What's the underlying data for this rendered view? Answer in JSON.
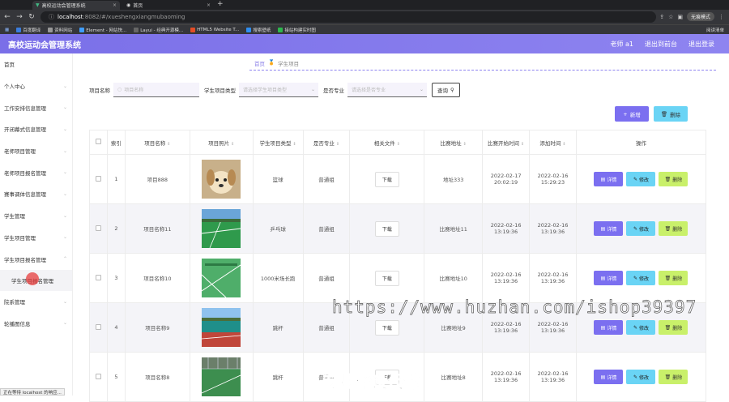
{
  "browser": {
    "tabs": [
      {
        "label": "高校运动会管理系统"
      },
      {
        "label": "首页"
      }
    ],
    "url_host": "localhost",
    "url_path": ":8082/#/xueshengxiangmubaoming",
    "profile": "无痕模式",
    "bookmarks": [
      "百度翻译",
      "资料网站",
      "Element - 网站快...",
      "Layui - 经典开源模...",
      "HTML5 Website T...",
      "搜索壁纸",
      "接站构建实时图"
    ],
    "bookmarks_right": "阅读清单"
  },
  "app": {
    "title": "高校运动会管理系统",
    "header_links": [
      "老师 a1",
      "退出到前台",
      "退出登录"
    ]
  },
  "sidebar": {
    "items": [
      {
        "label": "首页",
        "chev": ""
      },
      {
        "label": "个人中心",
        "chev": "⌄"
      },
      {
        "label": "工作安排信息管理",
        "chev": "⌄"
      },
      {
        "label": "开闭幕式信息管理",
        "chev": "⌄"
      },
      {
        "label": "老师项目管理",
        "chev": "⌄"
      },
      {
        "label": "老师项目报名管理",
        "chev": "⌄"
      },
      {
        "label": "赛事调体信息管理",
        "chev": "⌄"
      },
      {
        "label": "学生管理",
        "chev": "⌄"
      },
      {
        "label": "学生项目管理",
        "chev": "⌄"
      },
      {
        "label": "学生项目报名管理",
        "chev": "⌃"
      },
      {
        "label": "学生项目报名管理",
        "chev": "",
        "sub": true
      },
      {
        "label": "院系管理",
        "chev": "⌄"
      },
      {
        "label": "轮播图信息",
        "chev": "⌄"
      }
    ]
  },
  "breadcrumb": {
    "home": "首页",
    "current": "学生项目"
  },
  "filters": {
    "name_label": "项目名称",
    "name_placeholder": "项目名称",
    "type_label": "学生项目类型",
    "type_placeholder": "请选择学生项目类型",
    "major_label": "是否专业",
    "major_placeholder": "请选择是否专业",
    "query_label": "查询"
  },
  "actions": {
    "add": "新增",
    "delete": "删除"
  },
  "table": {
    "headers": [
      "索引",
      "项目名称",
      "项目照片",
      "学生项目类型",
      "是否专业",
      "相关文件",
      "比赛地址",
      "比赛开始时间",
      "添加时间",
      "操作"
    ],
    "download_label": "下载",
    "op_labels": [
      "详情",
      "修改",
      "删除"
    ],
    "rows": [
      {
        "index": "1",
        "name": "项目888",
        "type": "篮球",
        "major": "普通组",
        "addr": "地址333",
        "start": "2022-02-17 20:02:19",
        "added": "2022-02-16 15:29:23",
        "thumb": "dog"
      },
      {
        "index": "2",
        "name": "项目名称11",
        "type": "乒乓球",
        "major": "普通组",
        "addr": "比赛地址11",
        "start": "2022-02-16 13:19:36",
        "added": "2022-02-16 13:19:36",
        "thumb": "field1"
      },
      {
        "index": "3",
        "name": "项目名称10",
        "type": "1000米场长跑",
        "major": "普通组",
        "addr": "比赛地址10",
        "start": "2022-02-16 13:19:36",
        "added": "2022-02-16 13:19:36",
        "thumb": "field2"
      },
      {
        "index": "4",
        "name": "项目名称9",
        "type": "跳杆",
        "major": "普通组",
        "addr": "比赛地址9",
        "start": "2022-02-16 13:19:36",
        "added": "2022-02-16 13:19:36",
        "thumb": "field3"
      },
      {
        "index": "5",
        "name": "项目名称8",
        "type": "跳杆",
        "major": "普通组",
        "addr": "比赛地址8",
        "start": "2022-02-16 13:19:36",
        "added": "2022-02-16 13:19:36",
        "thumb": "field4"
      }
    ]
  },
  "watermark": "https://www.huzhan.com/ishop39397",
  "watermark2": "专业毕设代做",
  "status_bar": "正在等待 localhost 的响应..."
}
